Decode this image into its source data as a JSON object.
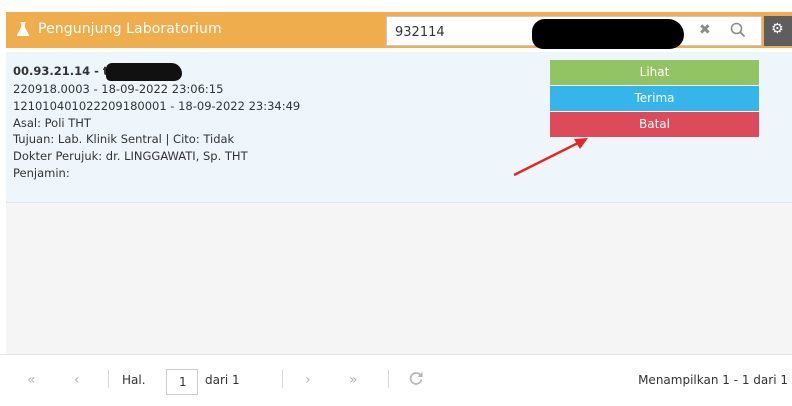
{
  "header": {
    "title": "Pengunjung Laboratorium",
    "icon": "flask-icon",
    "color": "#f0ad4e"
  },
  "search": {
    "value": "932114",
    "clear_icon": "times-icon",
    "search_icon": "search-icon"
  },
  "settings": {
    "icon": "gear-icon"
  },
  "record": {
    "id_prefix": "00.93.21.14 - t",
    "reg_line": "220918.0003 - 18-09-2022 23:06:15",
    "order_line": "121010401022209180001 - 18-09-2022 23:34:49",
    "asal": "Asal: Poli THT",
    "tujuan": "Tujuan: Lab. Klinik Sentral | Cito: Tidak",
    "dokter": "Dokter Perujuk: dr. LINGGAWATI, Sp. THT",
    "penjamin": "Penjamin:"
  },
  "actions": {
    "lihat": "Lihat",
    "terima": "Terima",
    "batal": "Batal",
    "colors": {
      "lihat": "#93c464",
      "terima": "#35b5e9",
      "batal": "#dd4a5a"
    }
  },
  "pager": {
    "first": "«",
    "prev": "‹",
    "hal_label": "Hal.",
    "page": "1",
    "dari_label": "dari 1",
    "next": "›",
    "last": "»",
    "refresh_icon": "refresh-icon",
    "info": "Menampilkan 1 - 1 dari 1"
  }
}
